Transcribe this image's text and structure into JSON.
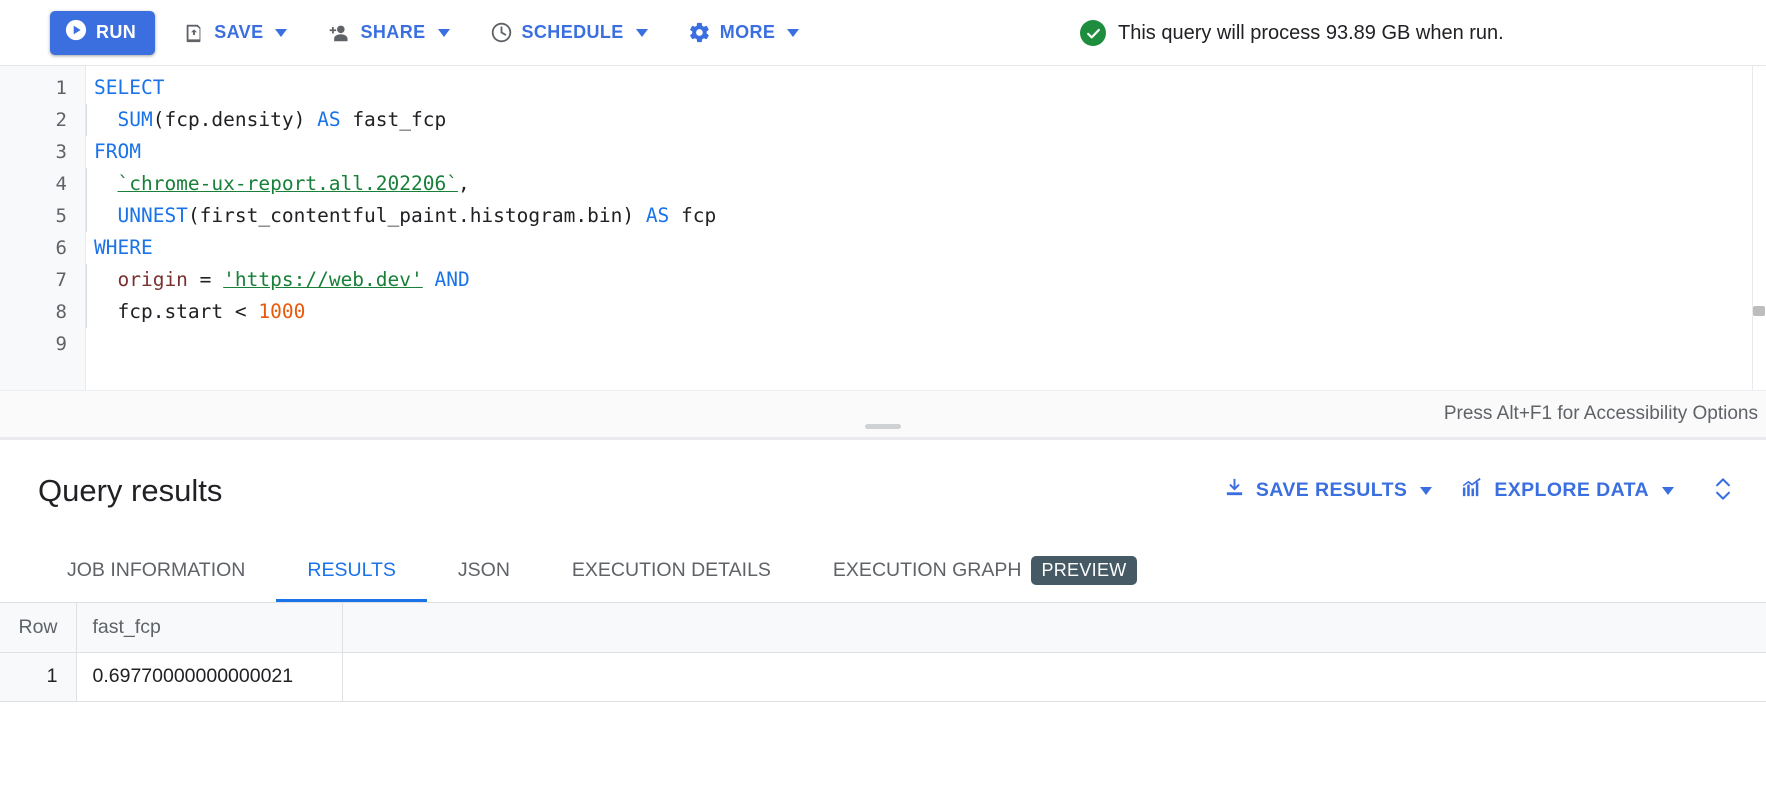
{
  "toolbar": {
    "run_label": "RUN",
    "save_label": "SAVE",
    "share_label": "SHARE",
    "schedule_label": "SCHEDULE",
    "more_label": "MORE",
    "status_text": "This query will process 93.89 GB when run.",
    "status_icon": "check-circle-icon",
    "status_color": "#1e8e3e",
    "accent_color": "#3b6fe0"
  },
  "editor": {
    "line_numbers": [
      "1",
      "2",
      "3",
      "4",
      "5",
      "6",
      "7",
      "8",
      "9"
    ],
    "lines": [
      {
        "n": "1",
        "indent": false,
        "tokens": [
          {
            "t": "SELECT",
            "c": "kw"
          }
        ]
      },
      {
        "n": "2",
        "indent": true,
        "tokens": [
          {
            "t": "  ",
            "c": "plain"
          },
          {
            "t": "SUM",
            "c": "kw"
          },
          {
            "t": "(fcp.density) ",
            "c": "plain"
          },
          {
            "t": "AS",
            "c": "kw"
          },
          {
            "t": " fast_fcp",
            "c": "plain"
          }
        ]
      },
      {
        "n": "3",
        "indent": false,
        "tokens": [
          {
            "t": "FROM",
            "c": "kw"
          }
        ]
      },
      {
        "n": "4",
        "indent": true,
        "tokens": [
          {
            "t": "  ",
            "c": "plain"
          },
          {
            "t": "`chrome-ux-report.all.202206`",
            "c": "str"
          },
          {
            "t": ",",
            "c": "plain"
          }
        ]
      },
      {
        "n": "5",
        "indent": true,
        "tokens": [
          {
            "t": "  ",
            "c": "plain"
          },
          {
            "t": "UNNEST",
            "c": "kw"
          },
          {
            "t": "(first_contentful_paint.histogram.bin) ",
            "c": "plain"
          },
          {
            "t": "AS",
            "c": "kw"
          },
          {
            "t": " fcp",
            "c": "plain"
          }
        ]
      },
      {
        "n": "6",
        "indent": false,
        "tokens": [
          {
            "t": "WHERE",
            "c": "kw"
          }
        ]
      },
      {
        "n": "7",
        "indent": true,
        "tokens": [
          {
            "t": "  ",
            "c": "plain"
          },
          {
            "t": "origin",
            "c": "fld"
          },
          {
            "t": " = ",
            "c": "plain"
          },
          {
            "t": "'https://web.dev'",
            "c": "str"
          },
          {
            "t": " ",
            "c": "plain"
          },
          {
            "t": "AND",
            "c": "kw"
          }
        ]
      },
      {
        "n": "8",
        "indent": true,
        "tokens": [
          {
            "t": "  ",
            "c": "plain"
          },
          {
            "t": "fcp.start ",
            "c": "plain"
          },
          {
            "t": "<",
            "c": "plain"
          },
          {
            "t": " 1000",
            "c": "num"
          }
        ]
      },
      {
        "n": "9",
        "indent": false,
        "tokens": []
      }
    ],
    "accessibility_hint": "Press Alt+F1 for Accessibility Options"
  },
  "results": {
    "title": "Query results",
    "save_results_label": "SAVE RESULTS",
    "explore_data_label": "EXPLORE DATA",
    "expand_icon": "expand-collapse-icon",
    "tabs": [
      {
        "label": "JOB INFORMATION",
        "active": false,
        "badge": ""
      },
      {
        "label": "RESULTS",
        "active": true,
        "badge": ""
      },
      {
        "label": "JSON",
        "active": false,
        "badge": ""
      },
      {
        "label": "EXECUTION DETAILS",
        "active": false,
        "badge": ""
      },
      {
        "label": "EXECUTION GRAPH",
        "active": false,
        "badge": "PREVIEW"
      }
    ],
    "table": {
      "columns": [
        "Row",
        "fast_fcp"
      ],
      "rows": [
        {
          "row": "1",
          "fast_fcp": "0.69770000000000021"
        }
      ]
    }
  }
}
